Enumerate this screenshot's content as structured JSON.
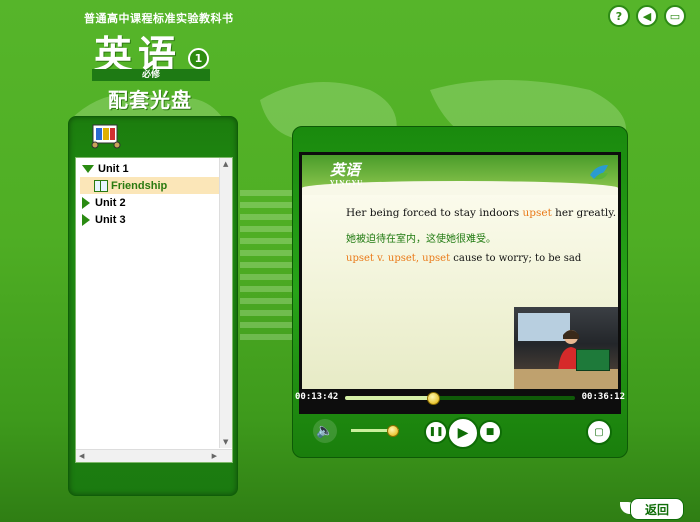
{
  "header": {
    "series": "普通高中课程标准实验教科书",
    "title": "英语",
    "volume": "1",
    "required": "必修",
    "subtitle": "配套光盘"
  },
  "top_icons": [
    "help-icon",
    "sound-icon",
    "minimize-icon"
  ],
  "tree": {
    "items": [
      {
        "label": "Unit 1",
        "expanded": true,
        "children": [
          {
            "label": "Friendship",
            "selected": true
          }
        ]
      },
      {
        "label": "Unit 2",
        "expanded": false
      },
      {
        "label": "Unit 3",
        "expanded": false
      }
    ]
  },
  "video": {
    "slide_logo": "英语",
    "slide_logo_sub": "YINGYU",
    "line1_pre": "Her being forced to stay indoors ",
    "line1_hl": "upset",
    "line1_post": " her greatly.",
    "line2": "她被迫待在室内，这使她很难受。",
    "line3_hl": "upset  v.  upset, upset",
    "line3_post": "  cause to worry; to be sad"
  },
  "player": {
    "current_time": "00:13:42",
    "total_time": "00:36:12",
    "progress": 0.38,
    "volume": 0.85
  },
  "colors": {
    "accent": "#2a8b12",
    "highlight": "#ea7a1a",
    "selected_row": "#fbe6b8"
  },
  "footer": {
    "back_label": "返回"
  }
}
